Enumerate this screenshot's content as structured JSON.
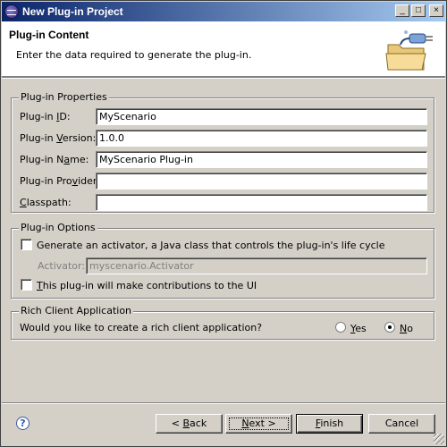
{
  "window": {
    "title": "New Plug-in Project"
  },
  "titlebar_buttons": {
    "minimize": "_",
    "maximize": "□",
    "close": "×"
  },
  "header": {
    "title": "Plug-in Content",
    "description": "Enter the data required to generate the plug-in."
  },
  "properties": {
    "legend": "Plug-in Properties",
    "id_label_pre": "Plug-in ",
    "id_label_key": "I",
    "id_label_post": "D:",
    "id_value": "MyScenario",
    "version_label_pre": "Plug-in ",
    "version_label_key": "V",
    "version_label_post": "ersion:",
    "version_value": "1.0.0",
    "name_label_pre": "Plug-in N",
    "name_label_key": "a",
    "name_label_post": "me:",
    "name_value": "MyScenario Plug-in",
    "provider_label_pre": "Plug-in Pro",
    "provider_label_key": "v",
    "provider_label_post": "ider:",
    "provider_value": "",
    "classpath_label_key": "C",
    "classpath_label_post": "lasspath:",
    "classpath_value": ""
  },
  "options": {
    "legend": "Plug-in Options",
    "activator_check_label": "Generate an activator, a Java class that controls the plug-in's life cycle",
    "activator_label": "Activator:",
    "activator_value": "myscenario.Activator",
    "contributions_key": "T",
    "contributions_label": "his plug-in will make contributions to the UI"
  },
  "rcp": {
    "legend": "Rich Client Application",
    "question": "Would you like to create a rich client application?",
    "yes_key": "Y",
    "yes_rest": "es",
    "no_key": "N",
    "no_rest": "o"
  },
  "buttons": {
    "help": "?",
    "back_pre": "< ",
    "back_key": "B",
    "back_post": "ack",
    "next_key": "N",
    "next_post": "ext >",
    "finish_key": "F",
    "finish_post": "inish",
    "cancel": "Cancel"
  }
}
